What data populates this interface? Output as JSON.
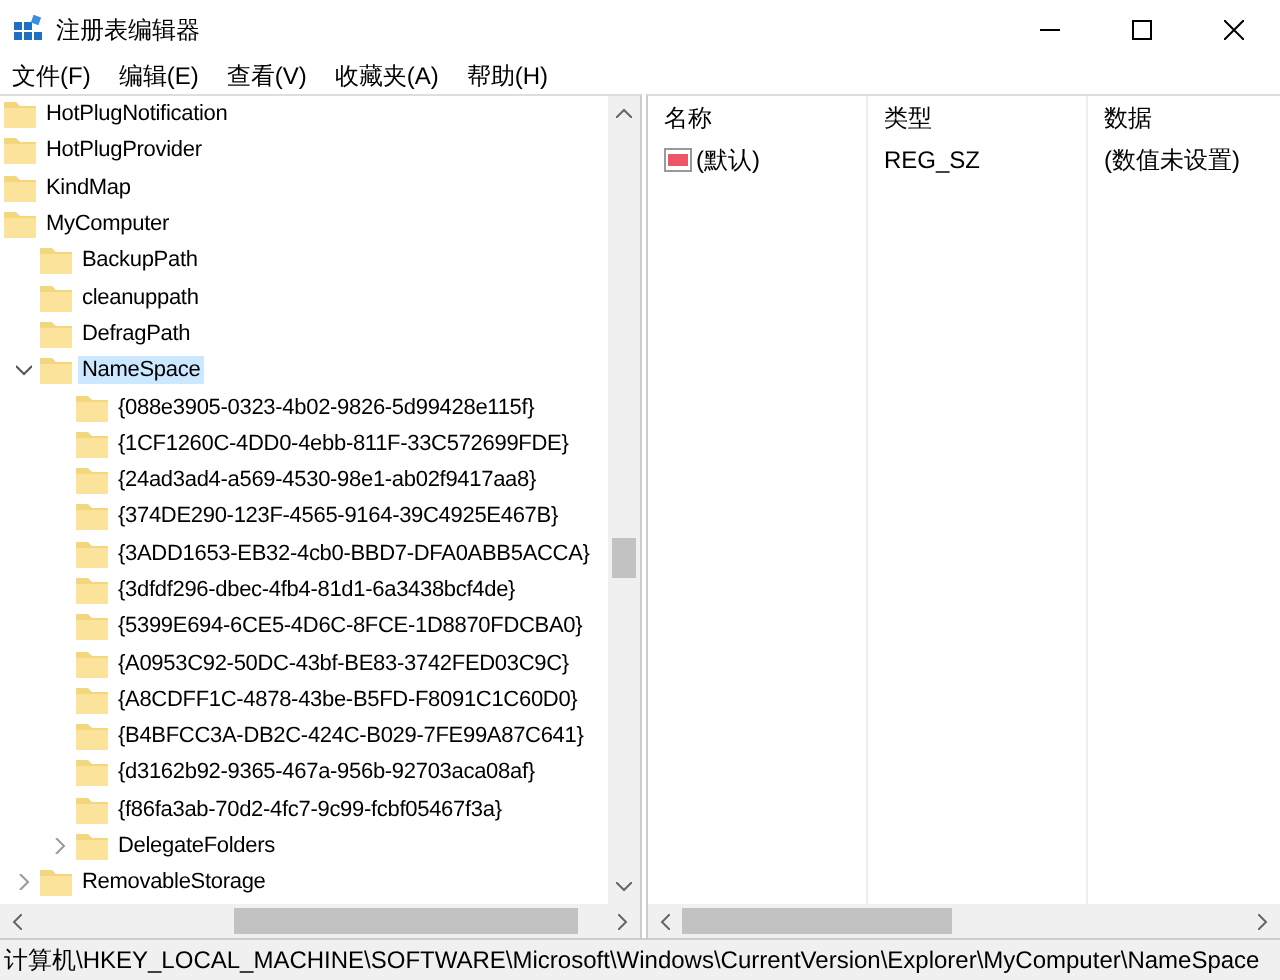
{
  "window": {
    "title": "注册表编辑器"
  },
  "menu": [
    "文件(F)",
    "编辑(E)",
    "查看(V)",
    "收藏夹(A)",
    "帮助(H)"
  ],
  "tree": [
    {
      "label": "HotPlugNotification",
      "selected": false
    },
    {
      "label": "HotPlugProvider",
      "selected": false
    },
    {
      "label": "KindMap",
      "selected": false
    },
    {
      "label": "MyComputer",
      "selected": false,
      "children": [
        {
          "label": "BackupPath",
          "selected": false
        },
        {
          "label": "cleanuppath",
          "selected": false
        },
        {
          "label": "DefragPath",
          "selected": false
        },
        {
          "label": "NameSpace",
          "selected": true,
          "expanded": true,
          "children": [
            {
              "label": "{088e3905-0323-4b02-9826-5d99428e115f}",
              "selected": false
            },
            {
              "label": "{1CF1260C-4DD0-4ebb-811F-33C572699FDE}",
              "selected": false
            },
            {
              "label": "{24ad3ad4-a569-4530-98e1-ab02f9417aa8}",
              "selected": false
            },
            {
              "label": "{374DE290-123F-4565-9164-39C4925E467B}",
              "selected": false
            },
            {
              "label": "{3ADD1653-EB32-4cb0-BBD7-DFA0ABB5ACCA}",
              "selected": false
            },
            {
              "label": "{3dfdf296-dbec-4fb4-81d1-6a3438bcf4de}",
              "selected": false
            },
            {
              "label": "{5399E694-6CE5-4D6C-8FCE-1D8870FDCBA0}",
              "selected": false
            },
            {
              "label": "{A0953C92-50DC-43bf-BE83-3742FED03C9C}",
              "selected": false
            },
            {
              "label": "{A8CDFF1C-4878-43be-B5FD-F8091C1C60D0}",
              "selected": false
            },
            {
              "label": "{B4BFCC3A-DB2C-424C-B029-7FE99A87C641}",
              "selected": false
            },
            {
              "label": "{d3162b92-9365-467a-956b-92703aca08af}",
              "selected": false
            },
            {
              "label": "{f86fa3ab-70d2-4fc7-9c99-fcbf05467f3a}",
              "selected": false
            },
            {
              "label": "DelegateFolders",
              "selected": false,
              "expanded": false
            }
          ]
        },
        {
          "label": "RemovableStorage",
          "selected": false,
          "expanded": false
        }
      ]
    }
  ],
  "values_table": {
    "columns": [
      "名称",
      "类型",
      "数据"
    ],
    "rows": [
      {
        "name": "(默认)",
        "type": "REG_SZ",
        "data": "(数值未设置)"
      }
    ]
  },
  "status_bar": "计算机\\HKEY_LOCAL_MACHINE\\SOFTWARE\\Microsoft\\Windows\\CurrentVersion\\Explorer\\MyComputer\\NameSpace"
}
